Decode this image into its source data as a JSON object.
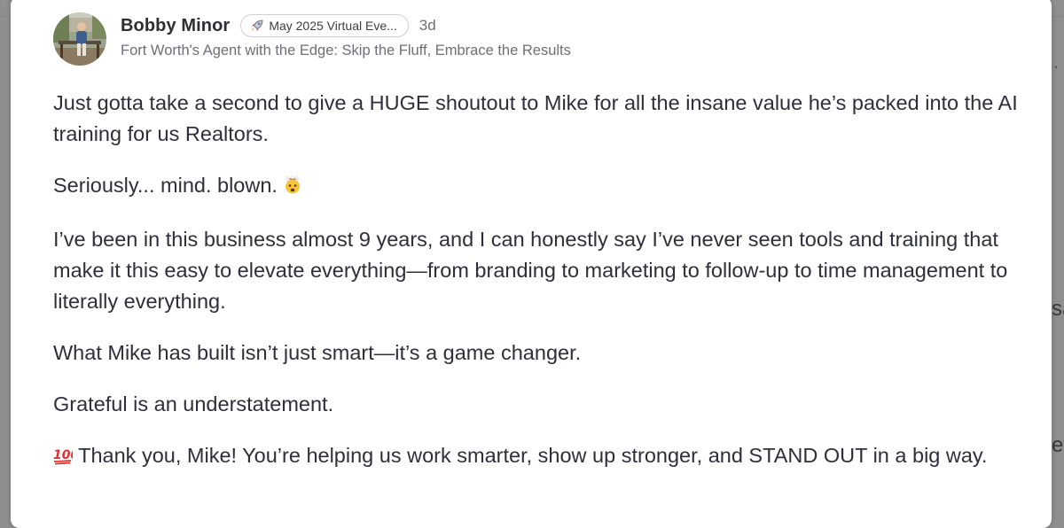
{
  "background": {
    "fragment_top": ".",
    "fragment_mid": "sa",
    "fragment_bottom": "ev"
  },
  "post": {
    "author_name": "Bobby Minor",
    "group_badge": "May 2025 Virtual Eve...",
    "age": "3d",
    "tagline": "Fort Worth's Agent with the Edge: Skip the Fluff, Embrace the Results",
    "paragraphs": {
      "p1": "Just gotta take a second to give a HUGE shoutout to Mike for all the insane value he’s packed into the AI training for us Realtors.",
      "p2": "Seriously... mind. blown.",
      "p3": "I’ve been in this business almost 9 years, and I can honestly say I’ve never seen tools and training that make it this easy to elevate everything—from branding to marketing to follow-up to time management to literally everything.",
      "p4": "What Mike has built isn’t just smart—it’s a game changer.",
      "p5": "Grateful is an understatement.",
      "p6": "Thank you, Mike! You’re helping us work smarter, show up stronger, and STAND OUT in a big way."
    },
    "icons": {
      "badge": "rocket-icon",
      "p2": "mind-blown-emoji-icon",
      "p6": "hundred-points-emoji-icon"
    },
    "colors": {
      "text": "#2d2f3a",
      "muted": "#6e6e78",
      "badge_border": "#cfcfd4"
    }
  }
}
